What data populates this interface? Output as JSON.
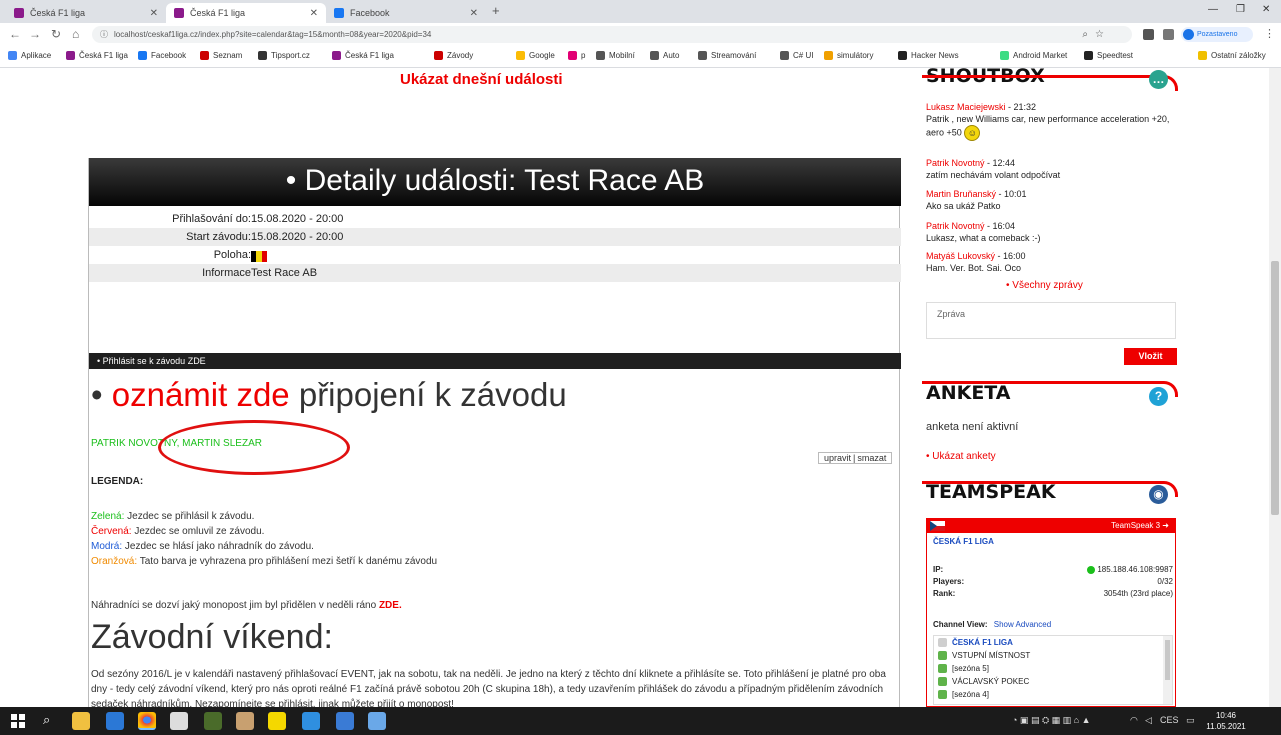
{
  "browser": {
    "tabs": [
      {
        "label": "Česká F1 liga",
        "active": false
      },
      {
        "label": "Česká F1 liga",
        "active": true
      },
      {
        "label": "Facebook",
        "active": false
      }
    ],
    "new_tab": "+",
    "url": "localhost/ceskaf1liga.cz/index.php?site=calendar&tag=15&month=08&year=2020&pid=34",
    "profile_label": "Pozastaveno",
    "bookmarks": [
      "Aplikace",
      "Česká F1 liga",
      "Facebook",
      "Seznam",
      "Tipsport.cz",
      "Česká F1 liga",
      "Závody",
      "Google",
      "p",
      "Mobilní",
      "Auto",
      "Streamování",
      "C# UI",
      "simulátory",
      "Hacker News",
      "Android Market",
      "Speedtest",
      "Ostatní záložky"
    ]
  },
  "page": {
    "today_link": "Ukázat dnešní události",
    "event": {
      "title": "• Detaily události: Test Race AB",
      "rows": [
        {
          "label": "Přihlašování do:",
          "value": "15.08.2020 - 20:00"
        },
        {
          "label": "Start závodu:",
          "value": "15.08.2020 - 20:00"
        },
        {
          "label": "Poloha:",
          "value": ""
        },
        {
          "label": "Informace",
          "value": "Test Race AB"
        }
      ],
      "flag_colors": [
        "#000000",
        "#f2d60c",
        "#e00000"
      ],
      "signup_bar": "• Přihlásit se k závodu ZDE",
      "announce_bullet": "•",
      "announce_red": "oznámit zde",
      "announce_rest": "připojení k závodu",
      "drivers": "PATRIK NOVOTNY, MARTIN SLEZAR",
      "edit": "upravit",
      "delete": "smazat",
      "legend_title": "LEGENDA:",
      "legend": [
        {
          "key": "Zelená:",
          "text": " Jezdec se přihlásil k závodu."
        },
        {
          "key": "Červená:",
          "text": " Jezdec se omluvil ze závodu."
        },
        {
          "key": "Modrá:",
          "text": " Jezdec se hlásí jako náhradník do závodu."
        },
        {
          "key": "Oranžová:",
          "text": " Tato barva je vyhrazena pro přihlášení mezi šetří k danému závodu"
        }
      ],
      "replacement_text": "Náhradníci se dozví jaký monopost jim byl přidělen v neděli ráno",
      "replacement_link": "ZDE.",
      "weekend_title": "Závodní víkend:",
      "weekend_text": "Od sezóny 2016/L je v kalendáři nastavený přihlašovací EVENT, jak na sobotu, tak na neděli. Je jedno na který z těchto dní kliknete a přihlásíte se. Toto přihlášení je platné pro oba dny - tedy celý závodní víkend, který pro nás oproti reálné F1 začíná právě sobotou 20h (C skupina 18h), a tedy uzavřením přihlášek do závodu a případným přidělením závodních sedaček náhradníkům. Nezapomínejte se přihlásit, jinak můžete přijít o monopost!"
    }
  },
  "sidebar": {
    "shoutbox": {
      "title": "SHOUTBOX",
      "messages": [
        {
          "who": "Lukasz Maciejewski",
          "time": " - 21:32",
          "text": "Patrik , new Williams car, new performance acceleration +20, aero +50",
          "smiley": true
        },
        {
          "who": "Patrik Novotný",
          "time": " - 12:44",
          "text": "zatím nechávám volant odpočívat",
          "smiley": false
        },
        {
          "who": "Martin Bruňanský",
          "time": " - 10:01",
          "text": "Ako sa ukáž Patko",
          "smiley": false
        },
        {
          "who": "Patrik Novotný",
          "time": " - 16:04",
          "text": "Lukasz, what a comeback :-)",
          "smiley": false
        },
        {
          "who": "Matyáš Lukovský",
          "time": " - 16:00",
          "text": "Ham. Ver. Bot. Sai. Oco",
          "smiley": false
        }
      ],
      "all_messages": "• Všechny zprávy",
      "input_placeholder": "Zpráva",
      "submit": "Vložit"
    },
    "poll": {
      "title": "ANKETA",
      "status": "anketa není aktivní",
      "link": "• Ukázat ankety"
    },
    "teamspeak": {
      "title": "TEAMSPEAK",
      "header": "TeamSpeak 3",
      "server": "ČESKÁ F1 LIGA",
      "ip_label": "IP:",
      "ip": "185.188.46.108:9987",
      "players_label": "Players:",
      "players": "0/32",
      "rank_label": "Rank:",
      "rank": "3054th (23rd place)",
      "channel_label": "Channel View:",
      "show_advanced": "Show Advanced",
      "tree": [
        "ČESKÁ F1 LIGA",
        "VSTUPNÍ MÍSTNOST",
        "[sezóna 5]",
        "VÁCLAVSKÝ POKEC",
        "[sezóna 4]"
      ]
    }
  },
  "taskbar": {
    "clock_time": "10:46",
    "clock_date": "11.05.2021",
    "lang": "CES"
  }
}
